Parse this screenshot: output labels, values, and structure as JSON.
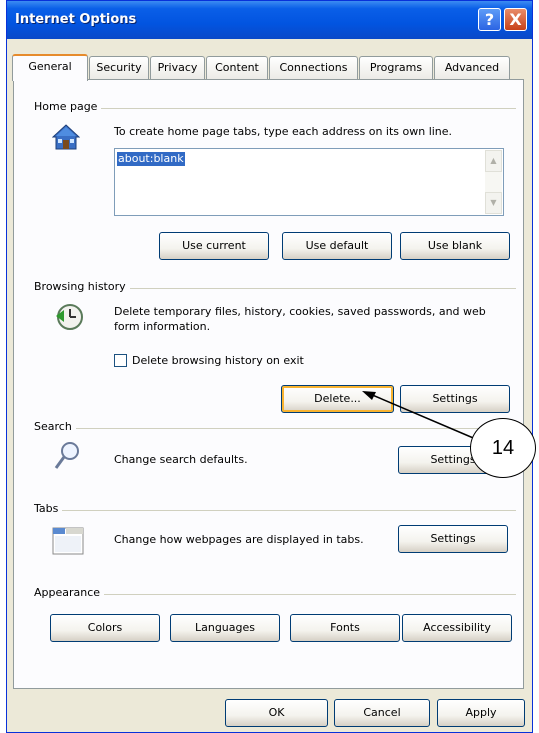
{
  "window": {
    "title": "Internet Options"
  },
  "titlebar_buttons": {
    "help": "?",
    "close": "X"
  },
  "tabs": [
    {
      "label": "General",
      "active": true
    },
    {
      "label": "Security"
    },
    {
      "label": "Privacy"
    },
    {
      "label": "Content"
    },
    {
      "label": "Connections"
    },
    {
      "label": "Programs"
    },
    {
      "label": "Advanced"
    }
  ],
  "home_page": {
    "group_label": "Home page",
    "instruction": "To create home page tabs, type each address on its own line.",
    "value": "about:blank",
    "buttons": {
      "use_current": "Use current",
      "use_default": "Use default",
      "use_blank": "Use blank"
    }
  },
  "browsing_history": {
    "group_label": "Browsing history",
    "description": "Delete temporary files, history, cookies, saved passwords, and web form information.",
    "checkbox_label": "Delete browsing history on exit",
    "checkbox_checked": false,
    "buttons": {
      "delete": "Delete...",
      "settings": "Settings"
    }
  },
  "search": {
    "group_label": "Search",
    "description": "Change search defaults.",
    "settings": "Settings"
  },
  "tabs_group": {
    "group_label": "Tabs",
    "description": "Change how webpages are displayed in tabs.",
    "settings": "Settings"
  },
  "appearance": {
    "group_label": "Appearance",
    "buttons": {
      "colors": "Colors",
      "languages": "Languages",
      "fonts": "Fonts",
      "accessibility": "Accessibility"
    }
  },
  "dialog_buttons": {
    "ok": "OK",
    "cancel": "Cancel",
    "apply": "Apply"
  },
  "callout": {
    "number": "14"
  },
  "colors": {
    "titlebar": "#0254e0",
    "face": "#ece9d8",
    "selection": "#316ac5",
    "focus": "#f8b330"
  }
}
